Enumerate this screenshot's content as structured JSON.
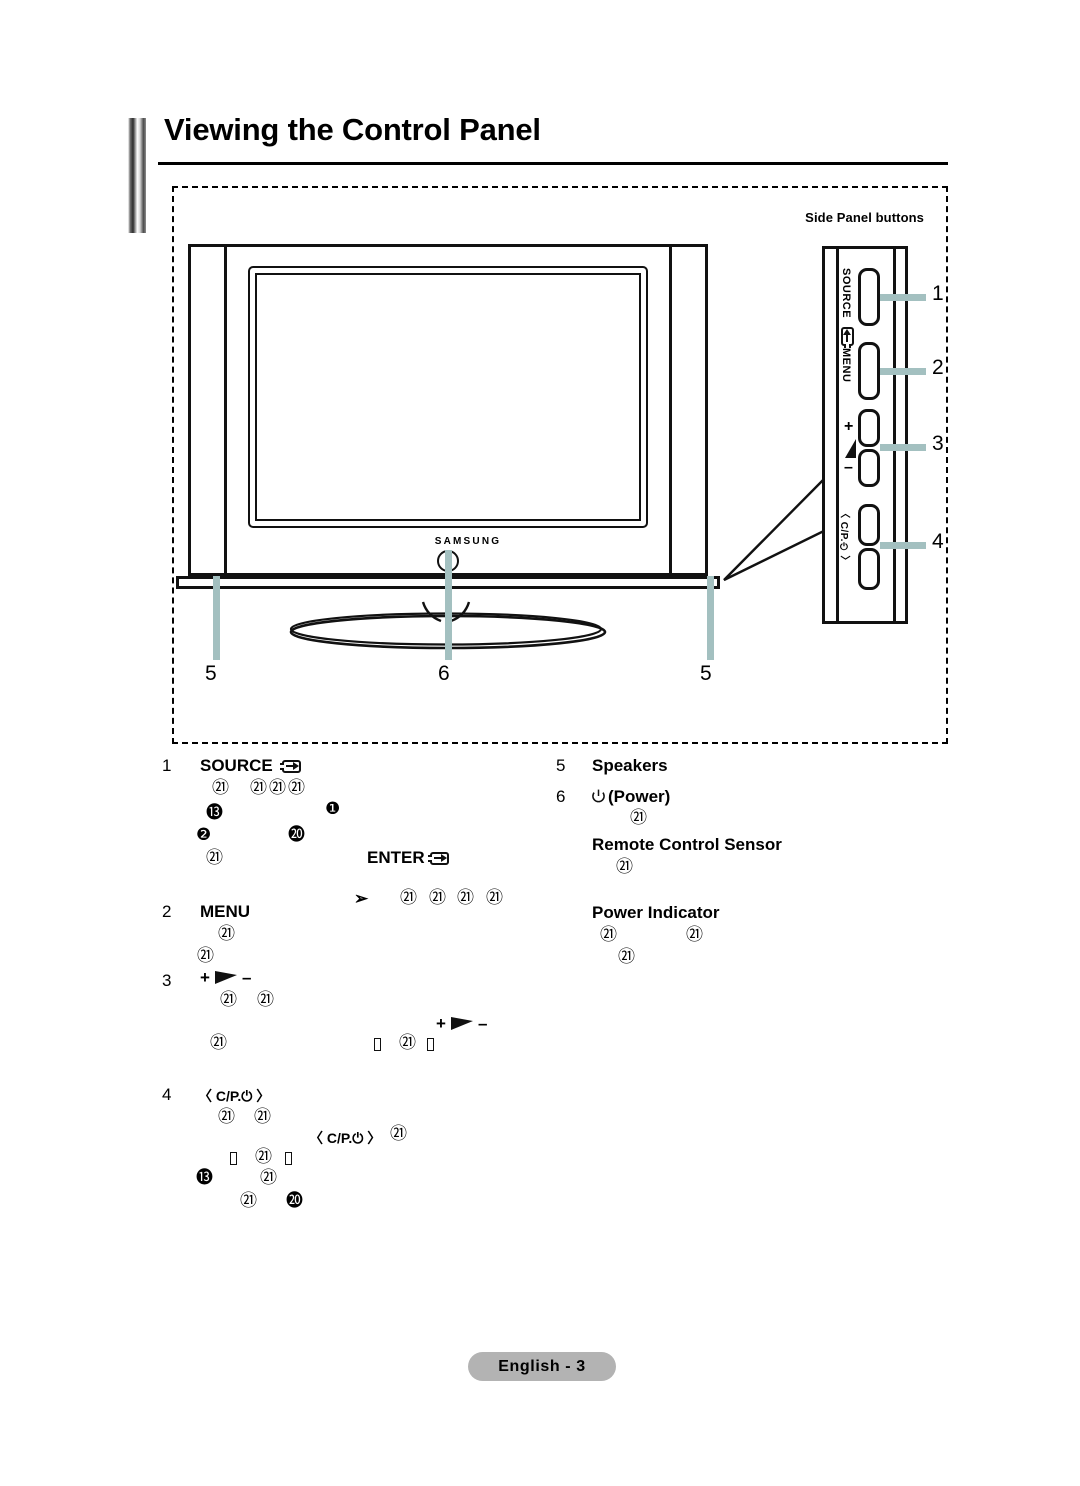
{
  "page": {
    "title": "Viewing the Control Panel",
    "footer_label": "English - 3"
  },
  "figure": {
    "side_panel_caption": "Side Panel buttons",
    "brand_logo": "SAMSUNG",
    "note_arrow_glyph": "➢",
    "side_panel_buttons": [
      {
        "label": "SOURCE",
        "icon": "source-enter-icon",
        "callout": "1"
      },
      {
        "label": "MENU",
        "icon": null,
        "callout": "2"
      },
      {
        "label": "volume",
        "icon": "volume-wedge-icon",
        "plus": "+",
        "minus": "–",
        "callout": "3"
      },
      {
        "label": "C/P.",
        "icon": "channel-power-icon",
        "left_chevron": "〈",
        "right_chevron": "〉",
        "callout": "4"
      }
    ],
    "tv_callouts": [
      {
        "number": "5",
        "position": "left-speaker"
      },
      {
        "number": "6",
        "position": "power-indicator"
      },
      {
        "number": "5",
        "position": "right-speaker"
      }
    ],
    "note_markers": [
      "㉑",
      "㉑",
      "㉑",
      "㉑"
    ]
  },
  "legend": {
    "left_items": [
      {
        "number": "1",
        "label": "SOURCE",
        "icon": "source-enter-icon",
        "markers_row1": [
          "㉑",
          "㉑",
          "㉑",
          "㉑"
        ],
        "markers_row2": [
          "⓭",
          "❶"
        ],
        "markers_row3": [
          "❷",
          "⓴"
        ],
        "markers_row4": [
          "㉑"
        ],
        "enter_label": "ENTER",
        "enter_icon": "enter-icon"
      },
      {
        "number": "2",
        "label": "MENU",
        "markers_row1": [
          "㉑"
        ],
        "markers_row2": [
          "㉑"
        ]
      },
      {
        "number": "3",
        "label": "volume",
        "plus": "+",
        "minus": "–",
        "icon": "volume-wedge-icon",
        "markers_row1": [
          "㉑",
          "㉑"
        ],
        "markers_row2": [
          "㉑"
        ],
        "inline_markers": [
          "▯",
          "㉑",
          "▯"
        ],
        "inline_plus": "+",
        "inline_minus": "–"
      },
      {
        "number": "4",
        "label": "C/P.",
        "left_chevron": "〈",
        "right_chevron": "〉",
        "icon": "channel-power-icon",
        "markers_row1": [
          "㉑",
          "㉑"
        ],
        "markers_row2": [
          "㉑"
        ],
        "markers_row3": [
          "▯",
          "㉑",
          "▯"
        ],
        "markers_row4": [
          "⓭",
          "㉑"
        ],
        "markers_row5": [
          "㉑",
          "⓴"
        ]
      }
    ],
    "right_items": [
      {
        "number": "5",
        "label": "Speakers"
      },
      {
        "number": "6",
        "label": "(Power)",
        "icon": "power-icon",
        "markers": [
          "㉑"
        ]
      },
      {
        "number": "",
        "label": "Remote Control Sensor",
        "markers": [
          "㉑"
        ]
      },
      {
        "number": "",
        "label": "Power Indicator",
        "markers_row1": [
          "㉑",
          "㉑"
        ],
        "markers_row2": [
          "㉑"
        ]
      }
    ]
  },
  "colors": {
    "leader_line": "#a3c0c0",
    "footer_badge": "#b3b3b3",
    "ink": "#111111"
  }
}
